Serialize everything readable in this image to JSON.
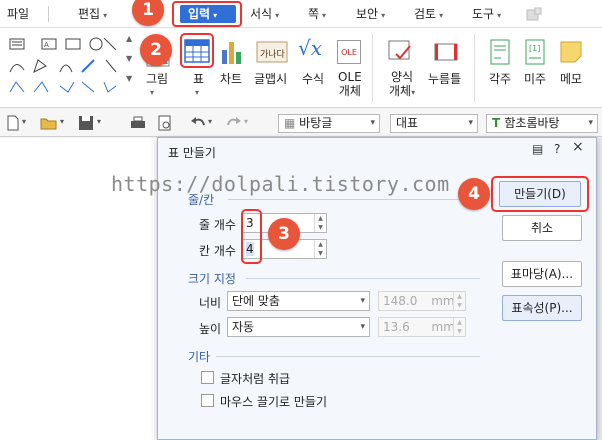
{
  "menu": {
    "items": [
      "파일",
      "편집",
      "입력",
      "서식",
      "쪽",
      "보안",
      "검토",
      "도구"
    ],
    "active_item": "입력"
  },
  "ribbon": {
    "items": [
      "그림",
      "표",
      "차트",
      "글맵시",
      "수식",
      "OLE 개체",
      "양식 개체",
      "누름틀",
      "각주",
      "미주",
      "메모"
    ],
    "ole_line1": "OLE",
    "ole_line2": "개체",
    "form_line1": "양식",
    "form_line2": "개체",
    "icon_glyph_chart_text": "가나다",
    "icon_glyph_equation": "√x",
    "icon_glyph_ole": "OLE"
  },
  "toolbar": {
    "style_value": "바탕글",
    "para_value": "대표",
    "font_value": "함초롬바탕"
  },
  "watermark": "https://dolpali.tistory.com",
  "badges": [
    "1",
    "2",
    "3",
    "4"
  ],
  "dialog": {
    "title": "표 만들기",
    "help_btn": "?",
    "close_btn": "×",
    "group_rowcol": "줄/칸",
    "rows_label": "줄 개수",
    "rows_value": "3",
    "cols_label": "칸 개수",
    "cols_value": "4",
    "group_size": "크기 지정",
    "width_label": "너비",
    "width_select": "단에 맞춤",
    "width_value": "148.0",
    "width_unit": "mm",
    "height_label": "높이",
    "height_select": "자동",
    "height_value": "13.6",
    "height_unit": "mm",
    "group_etc": "기타",
    "check_char": "글자처럼 취급",
    "check_mouse": "마우스 끌기로 만들기",
    "btn_create": "만들기(D)",
    "btn_cancel": "취소",
    "btn_tablestyle": "표마당(A)...",
    "btn_props": "표속성(P)..."
  },
  "colors": {
    "accent": "#2f6fd6",
    "badge": "#e8553b",
    "highlight": "#e33333"
  }
}
